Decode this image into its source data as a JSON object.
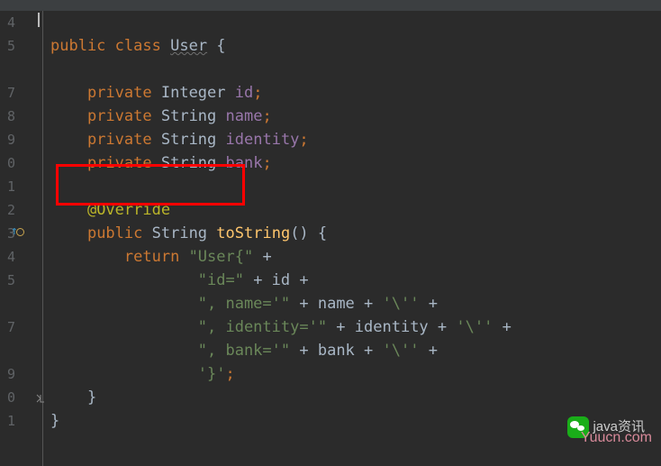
{
  "line_numbers": [
    "4",
    "5",
    "",
    "7",
    "8",
    "9",
    "0",
    "1",
    "2",
    "3",
    "4",
    "5",
    "",
    "7",
    "",
    "9",
    "0",
    "1"
  ],
  "code": {
    "class_decl": {
      "kw1": "public",
      "kw2": "class",
      "name": "User",
      "brace": " {"
    },
    "fields": [
      {
        "kw": "private",
        "type": "Integer",
        "name": "id",
        "semi": ";"
      },
      {
        "kw": "private",
        "type": "String",
        "name": "name",
        "semi": ";"
      },
      {
        "kw": "private",
        "type": "String",
        "name": "identity",
        "semi": ";"
      },
      {
        "kw": "private",
        "type": "String",
        "name": "bank",
        "semi": ";"
      }
    ],
    "annotation": "@Override",
    "method": {
      "kw1": "public",
      "type": "String",
      "name": "toString",
      "parens": "()",
      "brace": " {"
    },
    "return_kw": "return",
    "return_str": "\"User{\"",
    "plus": " + ",
    "concat": [
      {
        "str": "\"id=\"",
        "var": "id",
        "trail": " +"
      },
      {
        "str": "\", name='\"",
        "var": "name",
        "esc": "'\\''",
        "trail": " +"
      },
      {
        "str": "\", identity='\"",
        "var": "identity",
        "esc": "'\\''",
        "trail": " +"
      },
      {
        "str": "\", bank='\"",
        "var": "bank",
        "esc": "'\\''",
        "trail": " +"
      }
    ],
    "last": {
      "str": "'}'",
      "semi": ";"
    },
    "close_method": "}",
    "close_class": "}"
  },
  "watermark": "Yuucn.com",
  "wechat_label": "java资讯"
}
